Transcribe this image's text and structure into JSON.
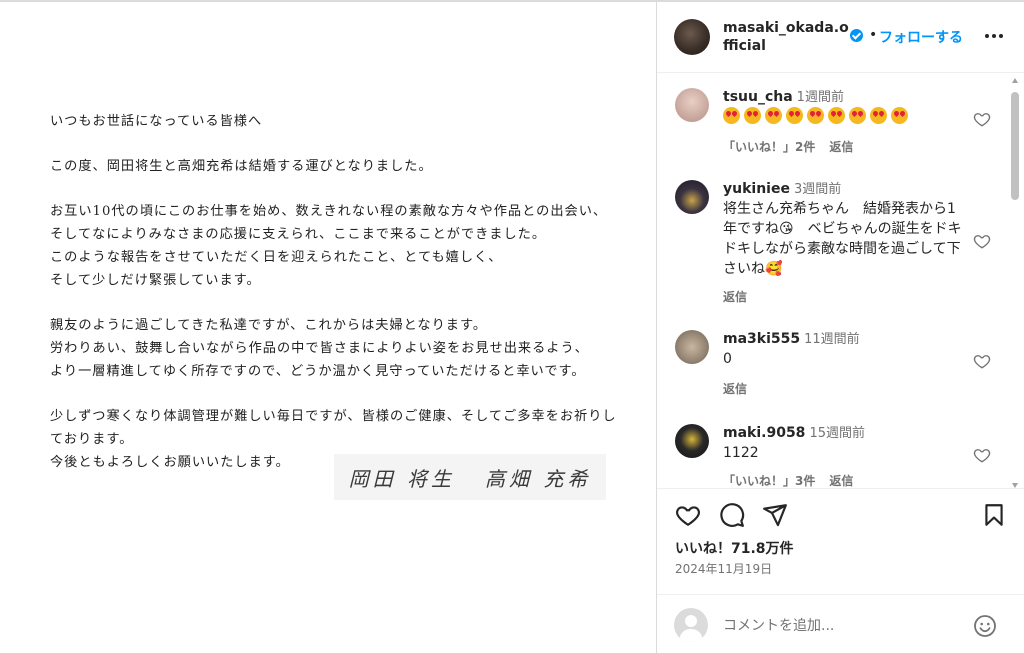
{
  "post": {
    "letter_lines": [
      "いつもお世話になっている皆様へ",
      "",
      "この度、岡田将生と高畑充希は結婚する運びとなりました。",
      "",
      "お互い10代の頃にこのお仕事を始め、数えきれない程の素敵な方々や作品との出会い、",
      "そしてなによりみなさまの応援に支えられ、ここまで来ることができました。",
      "このような報告をさせていただく日を迎えられたこと、とても嬉しく、",
      "そして少しだけ緊張しています。",
      "",
      "親友のように過ごしてきた私達ですが、これからは夫婦となります。",
      "労わりあい、鼓舞し合いながら作品の中で皆さまによりよい姿をお見せ出来るよう、",
      "より一層精進してゆく所存ですので、どうか温かく見守っていただけると幸いです。",
      "",
      "少しずつ寒くなり体調管理が難しい毎日ですが、皆様のご健康、そしてご多幸をお祈りし",
      "ております。",
      "今後ともよろしくお願いいたします。"
    ],
    "signature_1": "岡田 将生",
    "signature_2": "高畑 充希"
  },
  "header": {
    "username": "masaki_okada.official",
    "dot": "•",
    "follow_label": "フォローする"
  },
  "comments": [
    {
      "user": "tsuu_cha",
      "time": "1週間前",
      "text": "",
      "emoji_count": 9,
      "likes_label": "「いいね！」2件",
      "reply_label": "返信",
      "avatar_color": "#c9a59a"
    },
    {
      "user": "yukiniee",
      "time": "3週間前",
      "text": "将生さん充希ちゃん　結婚発表から1年ですね😘　ベビちゃんの誕生をドキドキしながら素敵な時間を過ごして下さいね🥰",
      "likes_label": "",
      "reply_label": "返信",
      "avatar_color": "#2b2a33"
    },
    {
      "user": "ma3ki555",
      "time": "11週間前",
      "text": "0",
      "likes_label": "",
      "reply_label": "返信",
      "avatar_color": "#8a7a6a"
    },
    {
      "user": "maki.9058",
      "time": "15週間前",
      "text": "1122",
      "likes_label": "「いいね！」3件",
      "reply_label": "返信",
      "avatar_color": "#1a1a1a"
    }
  ],
  "stats": {
    "likes": "いいね！71.8万件",
    "date": "2024年11月19日"
  },
  "comment_box": {
    "placeholder": "コメントを追加..."
  },
  "icons": {
    "like": "heart-icon",
    "comment": "comment-icon",
    "share": "send-icon",
    "save": "bookmark-icon",
    "emoji": "smile-icon"
  },
  "colors": {
    "accent": "#0095f6",
    "secondary_text": "#737373"
  }
}
